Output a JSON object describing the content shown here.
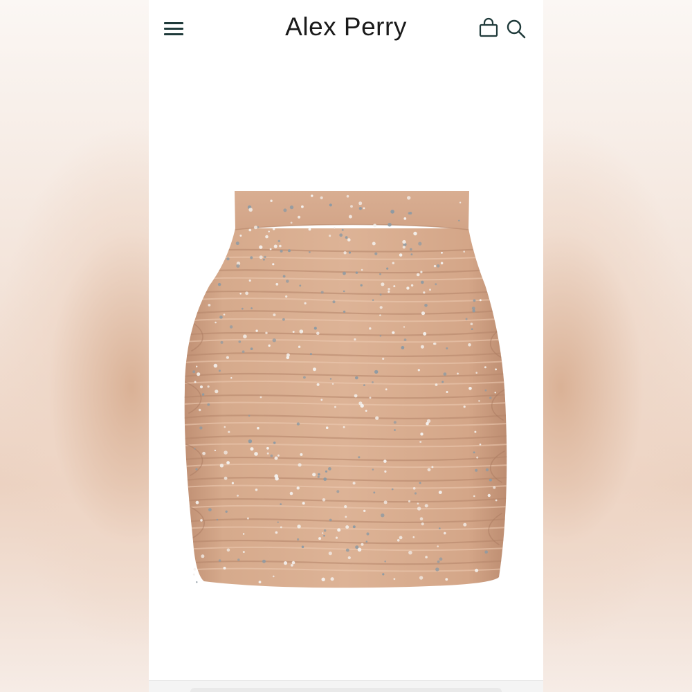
{
  "header": {
    "brand": "Alex Perry",
    "menu_icon": "hamburger-menu-icon",
    "bag_icon": "shopping-bag-icon",
    "search_icon": "search-icon"
  },
  "product": {
    "image": "ruched-crystal-mini-skirt-photo",
    "color": "#d2a485"
  },
  "colors": {
    "icon": "#1f3a3a",
    "text": "#1a1a1a",
    "background": "#ffffff"
  }
}
